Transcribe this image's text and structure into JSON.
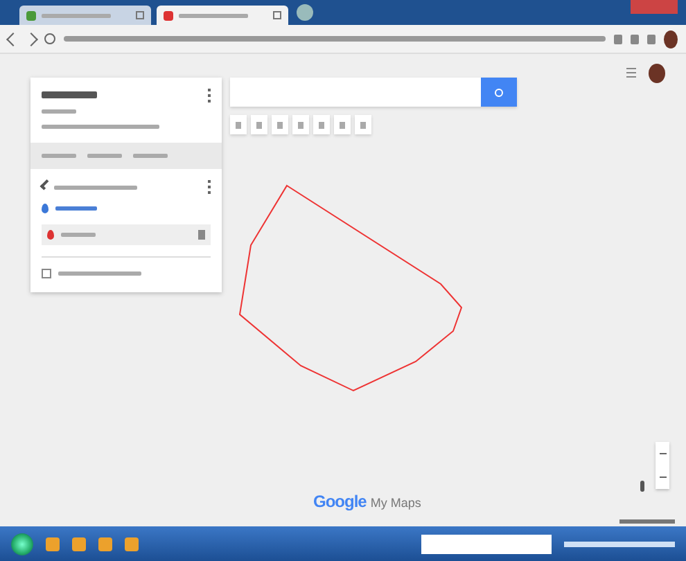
{
  "tabs": [
    {
      "selected": false
    },
    {
      "selected": true
    }
  ],
  "layers": [
    {
      "checked": true
    },
    {
      "checked": false
    }
  ],
  "branding": {
    "logo_word": "Google",
    "product": "My Maps"
  }
}
